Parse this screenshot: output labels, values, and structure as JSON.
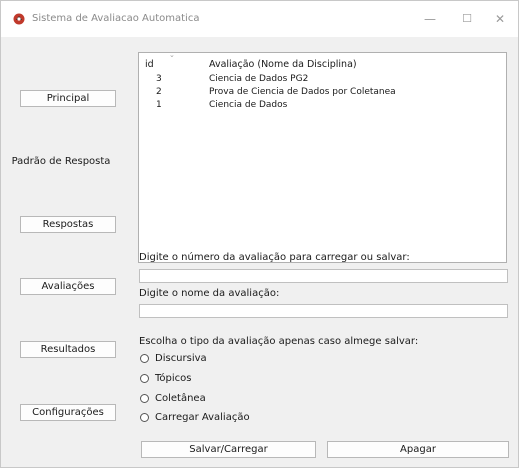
{
  "window": {
    "title": "Sistema de Avaliacao Automatica",
    "minimize_glyph": "—",
    "maximize_glyph": "☐",
    "close_glyph": "✕",
    "icon": "app-icon"
  },
  "sidebar": {
    "items": [
      {
        "label": "Principal"
      },
      {
        "label": "Padrão de Resposta"
      },
      {
        "label": "Respostas"
      },
      {
        "label": "Avaliações"
      },
      {
        "label": "Resultados"
      },
      {
        "label": "Configurações"
      }
    ]
  },
  "table": {
    "columns": [
      "id",
      "Avaliação (Nome da Disciplina)"
    ],
    "rows": [
      {
        "id": "3",
        "name": "Ciencia de Dados PG2"
      },
      {
        "id": "2",
        "name": "Prova de Ciencia de Dados por Coletanea"
      },
      {
        "id": "1",
        "name": "Ciencia de Dados"
      }
    ]
  },
  "form": {
    "number_label": "Digite o número da avaliação para carregar ou salvar:",
    "number_value": "",
    "name_label": "Digite o nome da avaliação:",
    "name_value": "",
    "type_label": "Escolha o tipo da avaliação apenas caso almege salvar:",
    "options": [
      "Discursiva",
      "Tópicos",
      "Coletânea",
      "Carregar Avaliação"
    ]
  },
  "actions": {
    "save_load": "Salvar/Carregar",
    "delete": "Apagar"
  }
}
